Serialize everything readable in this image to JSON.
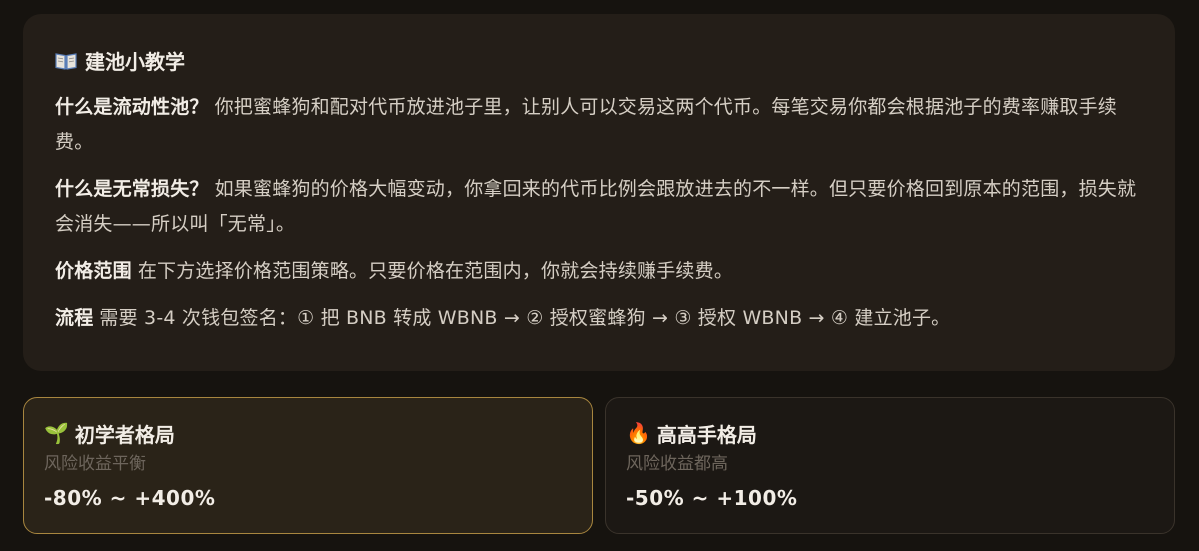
{
  "tutorial": {
    "icon": "open-book-icon",
    "title": "建池小教学",
    "sections": [
      {
        "label": "什么是流动性池？",
        "text": "你把蜜蜂狗和配对代币放进池子里，让别人可以交易这两个代币。每笔交易你都会根据池子的费率赚取手续费。"
      },
      {
        "label": "什么是无常损失？",
        "text": "如果蜜蜂狗的价格大幅变动，你拿回来的代币比例会跟放进去的不一样。但只要价格回到原本的范围，损失就会消失——所以叫「无常」。"
      },
      {
        "label": "价格范围",
        "text": "在下方选择价格范围策略。只要价格在范围内，你就会持续赚手续费。"
      },
      {
        "label": "流程",
        "text": "需要 3-4 次钱包签名：① 把 BNB 转成 WBNB → ② 授权蜜蜂狗 → ③ 授权 WBNB → ④ 建立池子。"
      }
    ]
  },
  "strategies": [
    {
      "icon": "seedling-icon",
      "glyph": "🌱",
      "name": "初学者格局",
      "description": "风险收益平衡",
      "range": "-80% ~ +400%",
      "selected": true
    },
    {
      "icon": "fire-icon",
      "glyph": "🔥",
      "name": "高高手格局",
      "description": "风险收益都高",
      "range": "-50% ~ +100%",
      "selected": false
    }
  ],
  "colors": {
    "background": "#16130f",
    "card": "#241e18",
    "selected_border": "#a8863f",
    "muted_text": "#6d655c"
  }
}
